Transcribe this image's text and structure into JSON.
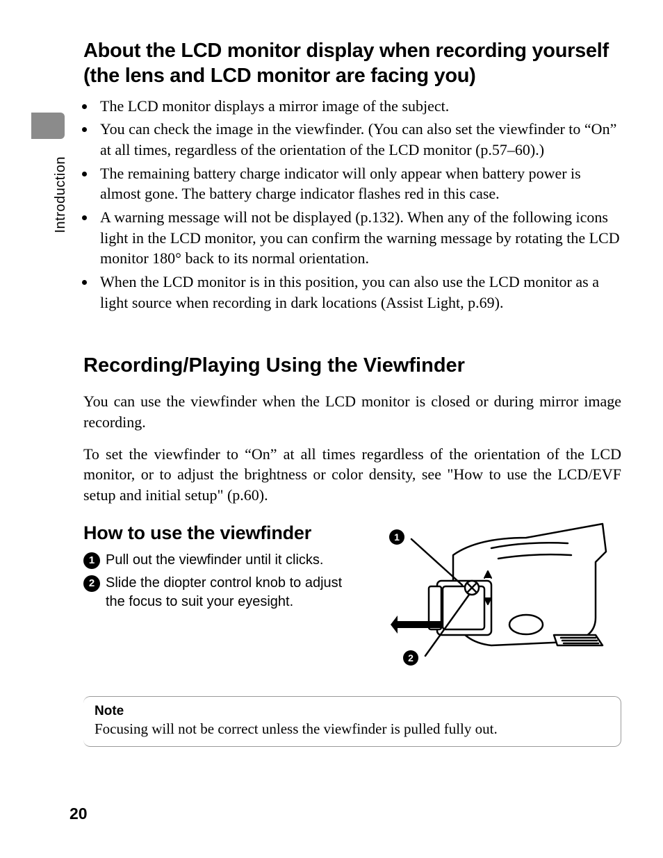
{
  "section_label": "Introduction",
  "heading1": "About the LCD monitor display when recording yourself (the lens and LCD monitor are facing you)",
  "bullets": [
    "The LCD monitor displays a mirror image of the subject.",
    "You can check the image in the viewfinder. (You can also set the viewfinder to “On” at all times, regardless of the orientation of the LCD monitor (p.57–60).)",
    "The remaining battery charge indicator will only appear when battery power is almost gone. The battery charge indicator flashes red in this case.",
    "A warning message will not be displayed (p.132). When any of the following icons light in the LCD monitor, you can confirm the warning message by rotating the LCD monitor 180° back to its normal orientation.",
    "When the LCD monitor is in this position, you can also use the LCD monitor as a light source when recording in dark locations (Assist Light, p.69)."
  ],
  "heading2": "Recording/Playing Using the Viewfinder",
  "para1": "You can use the viewfinder when the LCD monitor is closed or during mirror image recording.",
  "para2": "To set the viewfinder to “On” at all times regardless of the orientation of the LCD monitor, or to adjust the brightness or color density, see \"How to use the LCD/EVF setup and initial setup\" (p.60).",
  "heading3": "How to use the viewfinder",
  "steps": [
    {
      "n": "1",
      "text": "Pull out the viewfinder until it clicks."
    },
    {
      "n": "2",
      "text": "Slide the diopter control knob to adjust the focus to suit your eyesight."
    }
  ],
  "callouts": {
    "c1": "1",
    "c2": "2"
  },
  "note": {
    "title": "Note",
    "body": "Focusing will not be correct unless the viewfinder is pulled fully out."
  },
  "page_number": "20"
}
